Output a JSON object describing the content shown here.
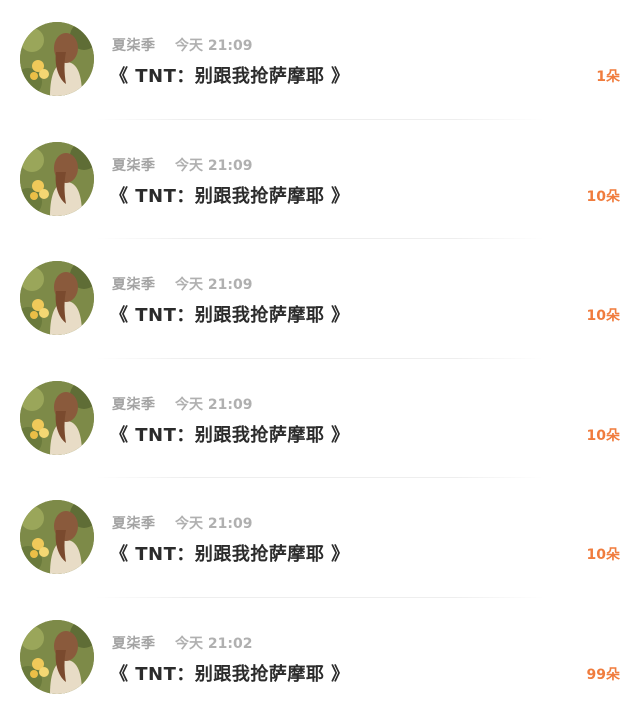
{
  "gifts": [
    {
      "sender": "夏柒季",
      "time": "今天 21:09",
      "title": "《 TNT：别跟我抢萨摩耶 》",
      "count": "1朵"
    },
    {
      "sender": "夏柒季",
      "time": "今天 21:09",
      "title": "《 TNT：别跟我抢萨摩耶 》",
      "count": "10朵"
    },
    {
      "sender": "夏柒季",
      "time": "今天 21:09",
      "title": "《 TNT：别跟我抢萨摩耶 》",
      "count": "10朵"
    },
    {
      "sender": "夏柒季",
      "time": "今天 21:09",
      "title": "《 TNT：别跟我抢萨摩耶 》",
      "count": "10朵"
    },
    {
      "sender": "夏柒季",
      "time": "今天 21:09",
      "title": "《 TNT：别跟我抢萨摩耶 》",
      "count": "10朵"
    },
    {
      "sender": "夏柒季",
      "time": "今天 21:02",
      "title": "《 TNT：别跟我抢萨摩耶 》",
      "count": "99朵"
    }
  ],
  "colors": {
    "accent": "#f07c3d",
    "title_text": "#2b2b2b",
    "meta_text": "#a3a3a3"
  }
}
